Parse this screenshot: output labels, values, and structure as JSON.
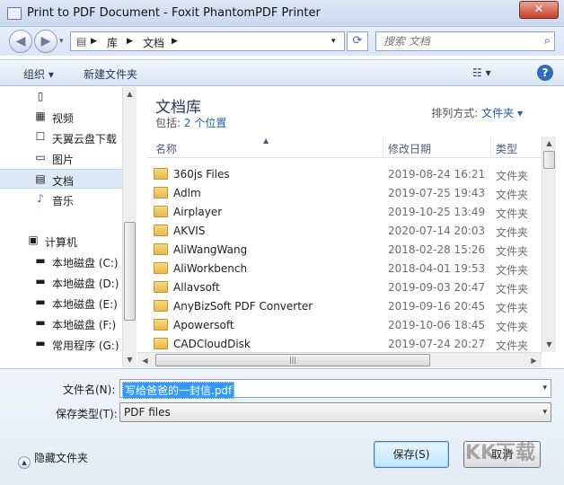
{
  "window": {
    "title": "Print to PDF Document - Foxit PhantomPDF Printer",
    "close_label": "✕"
  },
  "address": {
    "crumbs": [
      "库",
      "文档"
    ]
  },
  "search": {
    "placeholder": "搜索 文档"
  },
  "toolbar": {
    "organize": "组织 ▾",
    "new_folder": "新建文件夹",
    "view": "☷ ▾",
    "help": "?"
  },
  "nav": {
    "items": [
      {
        "label": "",
        "icon": "▯"
      },
      {
        "label": "视频",
        "icon": "▦"
      },
      {
        "label": "天翼云盘下载",
        "icon": "☐"
      },
      {
        "label": "图片",
        "icon": "▭"
      },
      {
        "label": "文档",
        "icon": "▤"
      },
      {
        "label": "音乐",
        "icon": "♪"
      },
      {
        "label": "计算机",
        "icon": "▣"
      },
      {
        "label": "本地磁盘 (C:)",
        "icon": "▬"
      },
      {
        "label": "本地磁盘 (D:)",
        "icon": "▬"
      },
      {
        "label": "本地磁盘 (E:)",
        "icon": "▬"
      },
      {
        "label": "本地磁盘 (F:)",
        "icon": "▬"
      },
      {
        "label": "常用程序 (G:)",
        "icon": "▬"
      }
    ]
  },
  "library": {
    "title": "文档库",
    "includes_label": "包括:",
    "locations": "2 个位置",
    "sort_label": "排列方式:",
    "sort_value": "文件夹 ▾"
  },
  "columns": {
    "name": "名称",
    "date": "修改日期",
    "type": "类型"
  },
  "rows": [
    {
      "name": "360js Files",
      "date": "2019-08-24 16:21",
      "type": "文件夹"
    },
    {
      "name": "Adlm",
      "date": "2019-07-25 19:43",
      "type": "文件夹"
    },
    {
      "name": "Airplayer",
      "date": "2019-10-25 13:49",
      "type": "文件夹"
    },
    {
      "name": "AKVIS",
      "date": "2020-07-14 20:03",
      "type": "文件夹"
    },
    {
      "name": "AliWangWang",
      "date": "2018-02-28 15:26",
      "type": "文件夹"
    },
    {
      "name": "AliWorkbench",
      "date": "2018-04-01 19:53",
      "type": "文件夹"
    },
    {
      "name": "Allavsoft",
      "date": "2019-09-03 20:47",
      "type": "文件夹"
    },
    {
      "name": "AnyBizSoft PDF Converter",
      "date": "2019-09-16 20:45",
      "type": "文件夹"
    },
    {
      "name": "Apowersoft",
      "date": "2019-10-06 18:45",
      "type": "文件夹"
    },
    {
      "name": "CADCloudDisk",
      "date": "2019-07-24 20:27",
      "type": "文件夹"
    }
  ],
  "form": {
    "filename_label": "文件名(N):",
    "filename_value": "写给爸爸的一封信.pdf",
    "filetype_label": "保存类型(T):",
    "filetype_value": "PDF files"
  },
  "buttons": {
    "hide_folders": "隐藏文件夹",
    "save": "保存(S)",
    "cancel": "取消"
  },
  "watermark": "KK下载"
}
